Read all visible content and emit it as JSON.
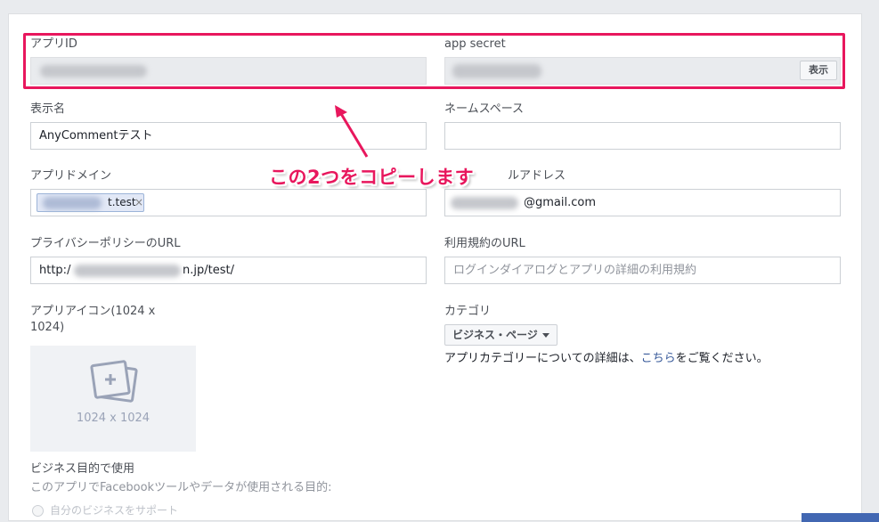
{
  "fields": {
    "app_id": {
      "label": "アプリID"
    },
    "app_secret": {
      "label": "app secret",
      "show_button": "表示"
    },
    "display_name": {
      "label": "表示名",
      "value": "AnyCommentテスト"
    },
    "namespace": {
      "label": "ネームスペース",
      "value": ""
    },
    "app_domains": {
      "label": "アプリドメイン",
      "token_text": "t.test",
      "token_remove": "×"
    },
    "contact_email": {
      "label": "ルアドレス",
      "value_suffix": "@gmail.com"
    },
    "privacy_url": {
      "label": "プライバシーポリシーのURL",
      "value_prefix": "http:/",
      "value_suffix": "n.jp/test/"
    },
    "terms_url": {
      "label": "利用規約のURL",
      "placeholder": "ログインダイアログとアプリの詳細の利用規約"
    },
    "app_icon": {
      "label_line1": "アプリアイコン(1024 x",
      "label_line2": "1024)",
      "caption": "1024 x 1024"
    },
    "category": {
      "label": "カテゴリ",
      "selected": "ビジネス・ページ",
      "help_before": "アプリカテゴリーについての詳細は、",
      "help_link": "こちら",
      "help_after": "をご覧ください。"
    },
    "business_use": {
      "label": "ビジネス目的で使用",
      "sub_label": "このアプリでFacebookツールやデータが使用される目的:",
      "option": "自分のビジネスをサポート"
    }
  },
  "annotation": {
    "callout": "この2つをコピーします",
    "color": "#e8175d"
  },
  "icons": {
    "image_placeholder": "image-placeholder-icon",
    "dropdown": "caret-down-icon",
    "arrow": "annotation-arrow"
  }
}
